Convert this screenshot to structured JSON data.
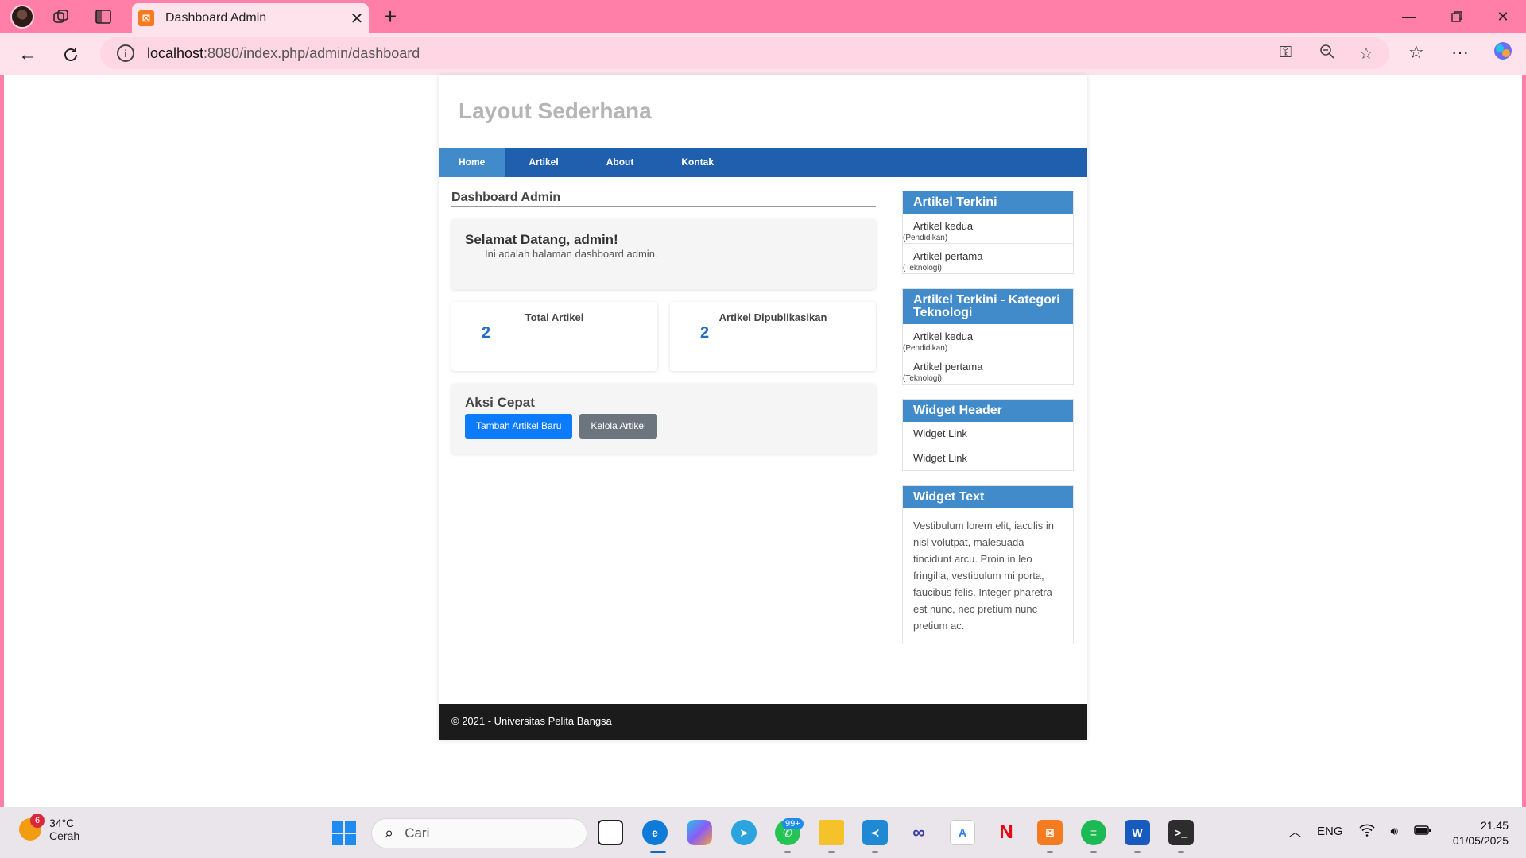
{
  "browser": {
    "tab_title": "Dashboard Admin",
    "tab_favicon": "xampp-icon",
    "url_host": "localhost",
    "url_path": ":8080/index.php/admin/dashboard"
  },
  "site": {
    "title": "Layout Sederhana",
    "nav": [
      "Home",
      "Artikel",
      "About",
      "Kontak"
    ],
    "active_nav": "Home",
    "accent_color": "#428bca",
    "nav_color": "#1f5fad"
  },
  "main": {
    "heading": "Dashboard Admin",
    "welcome_title": "Selamat Datang, admin!",
    "welcome_text": "Ini adalah halaman dashboard admin.",
    "stats": [
      {
        "label": "Total Artikel",
        "value": "2"
      },
      {
        "label": "Artikel Dipublikasikan",
        "value": "2"
      }
    ],
    "quick_title": "Aksi Cepat",
    "btn_add": "Tambah Artikel Baru",
    "btn_manage": "Kelola Artikel"
  },
  "sidebar": {
    "w1_title": "Artikel Terkini",
    "w1_items": [
      {
        "name": "Artikel kedua",
        "cat": "(Pendidikan)"
      },
      {
        "name": "Artikel pertama",
        "cat": "(Teknologi)"
      }
    ],
    "w2_title": "Artikel Terkini - Kategori Teknologi",
    "w2_items": [
      {
        "name": "Artikel kedua",
        "cat": "(Pendidikan)"
      },
      {
        "name": "Artikel pertama",
        "cat": "(Teknologi)"
      }
    ],
    "w3_title": "Widget Header",
    "w3_links": [
      "Widget Link",
      "Widget Link"
    ],
    "w4_title": "Widget Text",
    "w4_text": "Vestibulum lorem elit, iaculis in nisl volutpat, malesuada tincidunt arcu. Proin in leo fringilla, vestibulum mi porta, faucibus felis. Integer pharetra est nunc, nec pretium nunc pretium ac."
  },
  "footer": {
    "text": "© 2021 - Universitas Pelita Bangsa"
  },
  "taskbar": {
    "weather_badge": "6",
    "temp": "34°C",
    "cond": "Cerah",
    "search_placeholder": "Cari",
    "whatsapp_badge": "99+",
    "lang": "ENG",
    "time": "21.45",
    "date": "01/05/2025"
  }
}
